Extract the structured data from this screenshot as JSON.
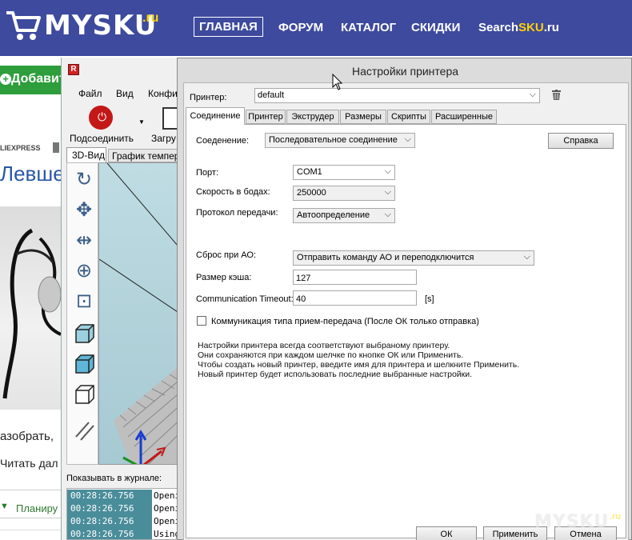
{
  "site": {
    "logo_text": "MYSKU",
    "logo_suffix": ".ru",
    "nav": {
      "home": "ГЛАВНАЯ",
      "forum": "ФОРУМ",
      "catalog": "КАТАЛОГ",
      "discounts": "СКИДКИ",
      "searchsku_prefix": "Search",
      "searchsku_hl": "SKU",
      "searchsku_suffix": ".ru"
    },
    "add_button": "Добавить",
    "tag": "LIEXPRESS",
    "title": "Левше",
    "text1": "азобрать,",
    "text2": "Читать дал",
    "tab_label": "Планиру"
  },
  "app": {
    "menu": {
      "file": "Файл",
      "view": "Вид",
      "config": "Конфи"
    },
    "toolbar": {
      "connect": "Подсоединить",
      "load": "Загру"
    },
    "tabs": {
      "view3d": "3D-Вид",
      "temp": "График температ"
    },
    "log_label": "Показывать в журнале:",
    "log": [
      {
        "time": "00:28:26.756",
        "msg": "Openi"
      },
      {
        "time": "00:28:26.756",
        "msg": "Openi"
      },
      {
        "time": "00:28:26.756",
        "msg": "Openi"
      },
      {
        "time": "00:28:26.756",
        "msg": "Using"
      }
    ]
  },
  "dialog": {
    "title": "Настройки принтера",
    "printer_label": "Принтер:",
    "printer_value": "default",
    "tabs": {
      "connection": "Соединение",
      "printer": "Принтер",
      "extruder": "Экструдер",
      "dimensions": "Размеры",
      "scripts": "Скрипты",
      "advanced": "Расширенные"
    },
    "connection_label": "Соеденение:",
    "connection_value": "Последовательное соединение",
    "help_button": "Справка",
    "port_label": "Порт:",
    "port_value": "COM1",
    "baud_label": "Скорость в бодах:",
    "baud_value": "250000",
    "protocol_label": "Протокол передачи:",
    "protocol_value": "Автоопределение",
    "reset_label": "Сброс при АО:",
    "reset_value": "Отправить команду АО и переподключится",
    "cache_label": "Размер кэша:",
    "cache_value": "127",
    "timeout_label": "Communication Timeout:",
    "timeout_value": "40",
    "timeout_unit": "[s]",
    "pingpong_label": "Коммуникация типа прием-передача (После ОК только отправка)",
    "info": {
      "line1": "Настройки принтера всегда соответствуют выбраному принтеру.",
      "line2": "Они сохраняются при каждом шелчке по кнопке ОК или Применить.",
      "line3": "Чтобы создать новый принтер, введите имя для принтера и шелкните Применить.",
      "line4": "Новый принтер будет использовать последние выбранные настройки."
    },
    "ok": "ОК",
    "apply": "Применить",
    "cancel": "Отмена"
  },
  "watermark": {
    "text": "MYSKU",
    "suffix": ".ru"
  },
  "colors": {
    "site_header": "#3e4a9e",
    "site_accent": "#ffd200",
    "add_green": "#2e9d3b",
    "log_time_bg": "#4a8d9a",
    "viewport_bg": "#b4d4dc"
  }
}
